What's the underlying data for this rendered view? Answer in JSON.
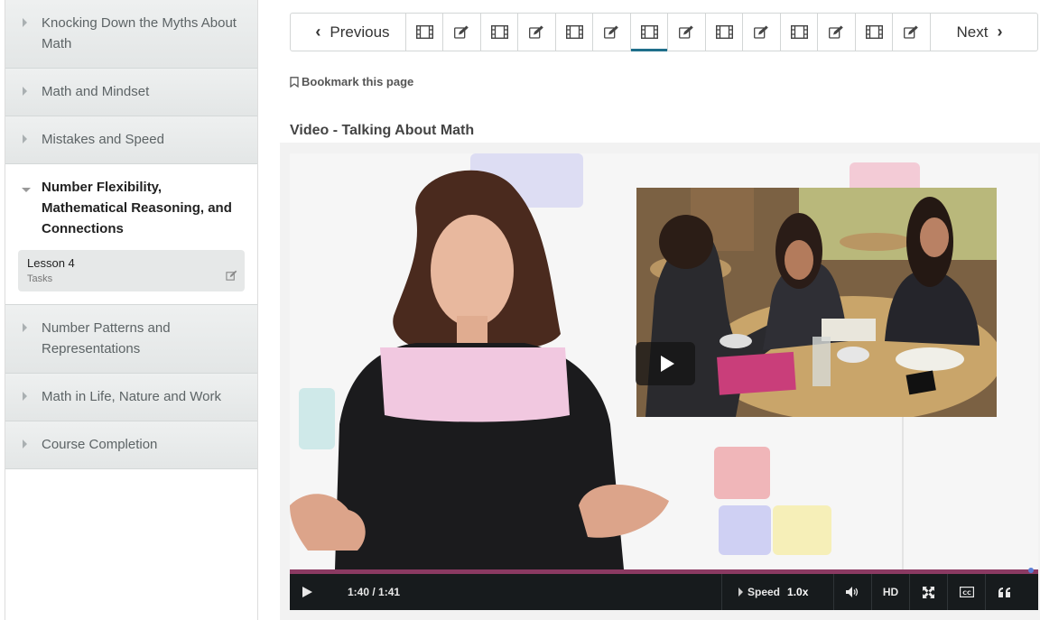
{
  "sidebar": {
    "sections": [
      {
        "label": "Knocking Down the Myths About Math"
      },
      {
        "label": "Math and Mindset"
      },
      {
        "label": "Mistakes and Speed"
      },
      {
        "label": "Number Flexibility, Mathematical Reasoning, and Connections"
      },
      {
        "label": "Number Patterns and Representations"
      },
      {
        "label": "Math in Life, Nature and Work"
      },
      {
        "label": "Course Completion"
      }
    ],
    "lesson": {
      "title": "Lesson 4",
      "subtitle": "Tasks"
    }
  },
  "nav": {
    "previous_label": "Previous",
    "next_label": "Next",
    "units": [
      "video-icon",
      "edit-icon",
      "video-icon",
      "edit-icon",
      "video-icon",
      "edit-icon",
      "video-icon",
      "edit-icon",
      "video-icon",
      "edit-icon",
      "video-icon",
      "edit-icon",
      "video-icon",
      "edit-icon"
    ],
    "active_index": 6
  },
  "bookmark_label": "Bookmark this page",
  "video": {
    "title": "Video - Talking About Math",
    "time": "1:40 / 1:41",
    "progress": 0.99,
    "speed_label": "Speed",
    "speed_value": "1.0x",
    "hd_label": "HD"
  }
}
